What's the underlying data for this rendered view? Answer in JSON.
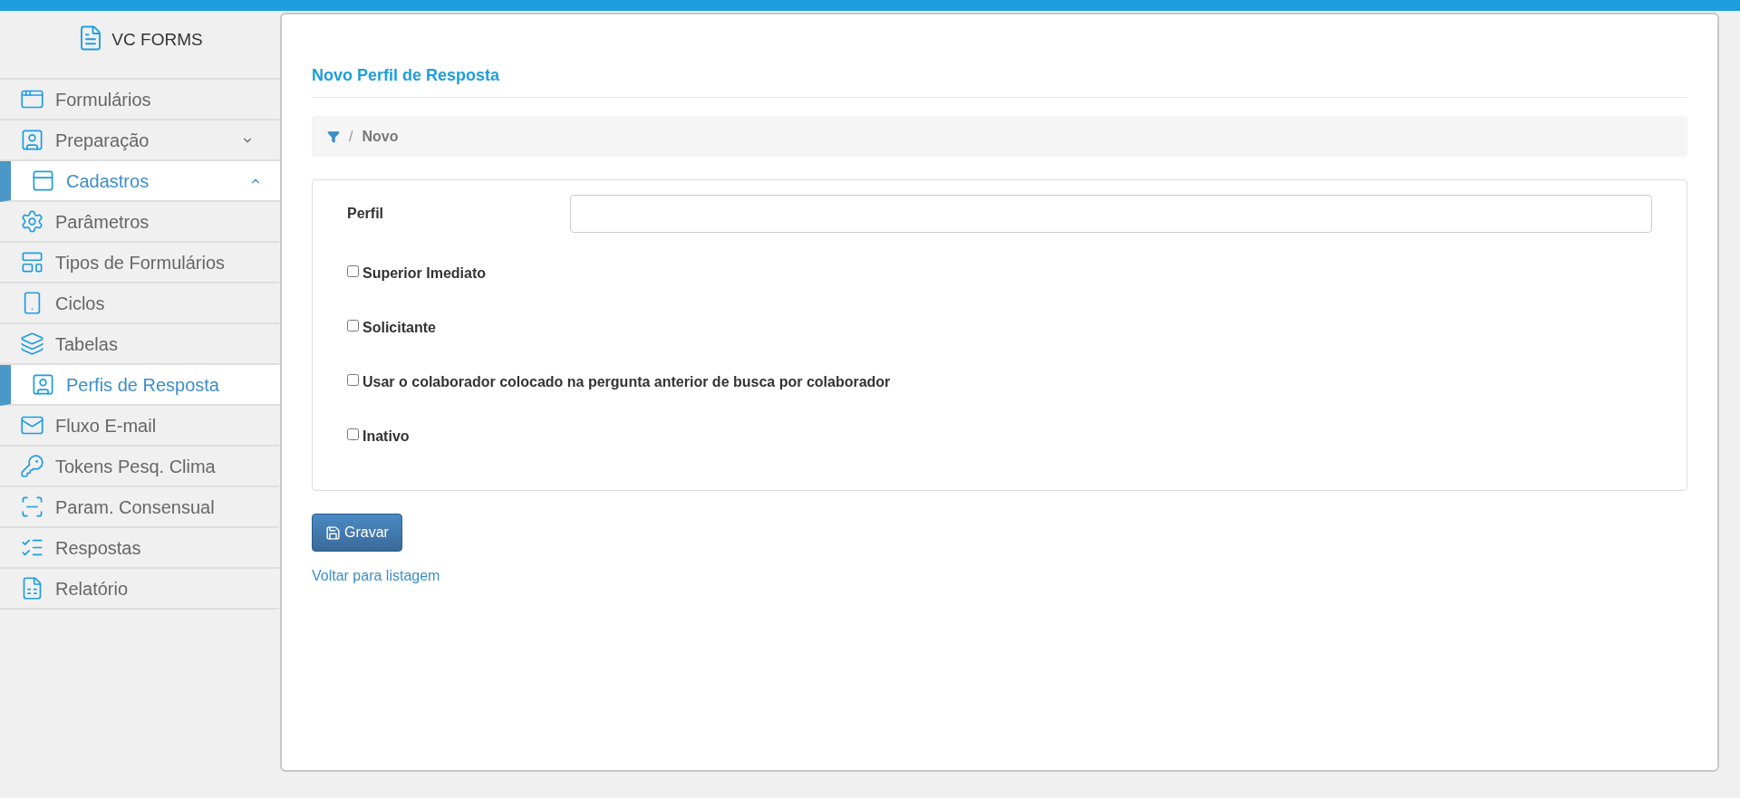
{
  "app": {
    "name": "VC FORMS"
  },
  "sidebar": {
    "items": [
      {
        "label": "Formulários",
        "selected": false
      },
      {
        "label": "Preparação",
        "selected": false,
        "expanded": false
      },
      {
        "label": "Cadastros",
        "selected": true,
        "expanded": true
      },
      {
        "label": "Parâmetros",
        "selected": false
      },
      {
        "label": "Tipos de Formulários",
        "selected": false
      },
      {
        "label": "Ciclos",
        "selected": false
      },
      {
        "label": "Tabelas",
        "selected": false
      },
      {
        "label": "Perfis de Resposta",
        "selected": true
      },
      {
        "label": "Fluxo E-mail",
        "selected": false
      },
      {
        "label": "Tokens Pesq. Clima",
        "selected": false
      },
      {
        "label": "Param. Consensual",
        "selected": false
      },
      {
        "label": "Respostas",
        "selected": false
      },
      {
        "label": "Relatório",
        "selected": false
      }
    ]
  },
  "page": {
    "title": "Novo Perfil de Resposta",
    "breadcrumb": {
      "separator": "/",
      "current": "Novo"
    },
    "form": {
      "field": {
        "label": "Perfil"
      },
      "checkboxes": [
        {
          "label": "Superior Imediato",
          "checked": false
        },
        {
          "label": "Solicitante",
          "checked": false
        },
        {
          "label": "Usar o colaborador colocado na pergunta anterior de busca por colaborador",
          "checked": false
        },
        {
          "label": "Inativo",
          "checked": false
        }
      ]
    },
    "save_button": "Gravar",
    "back_link": "Voltar para listagem"
  }
}
